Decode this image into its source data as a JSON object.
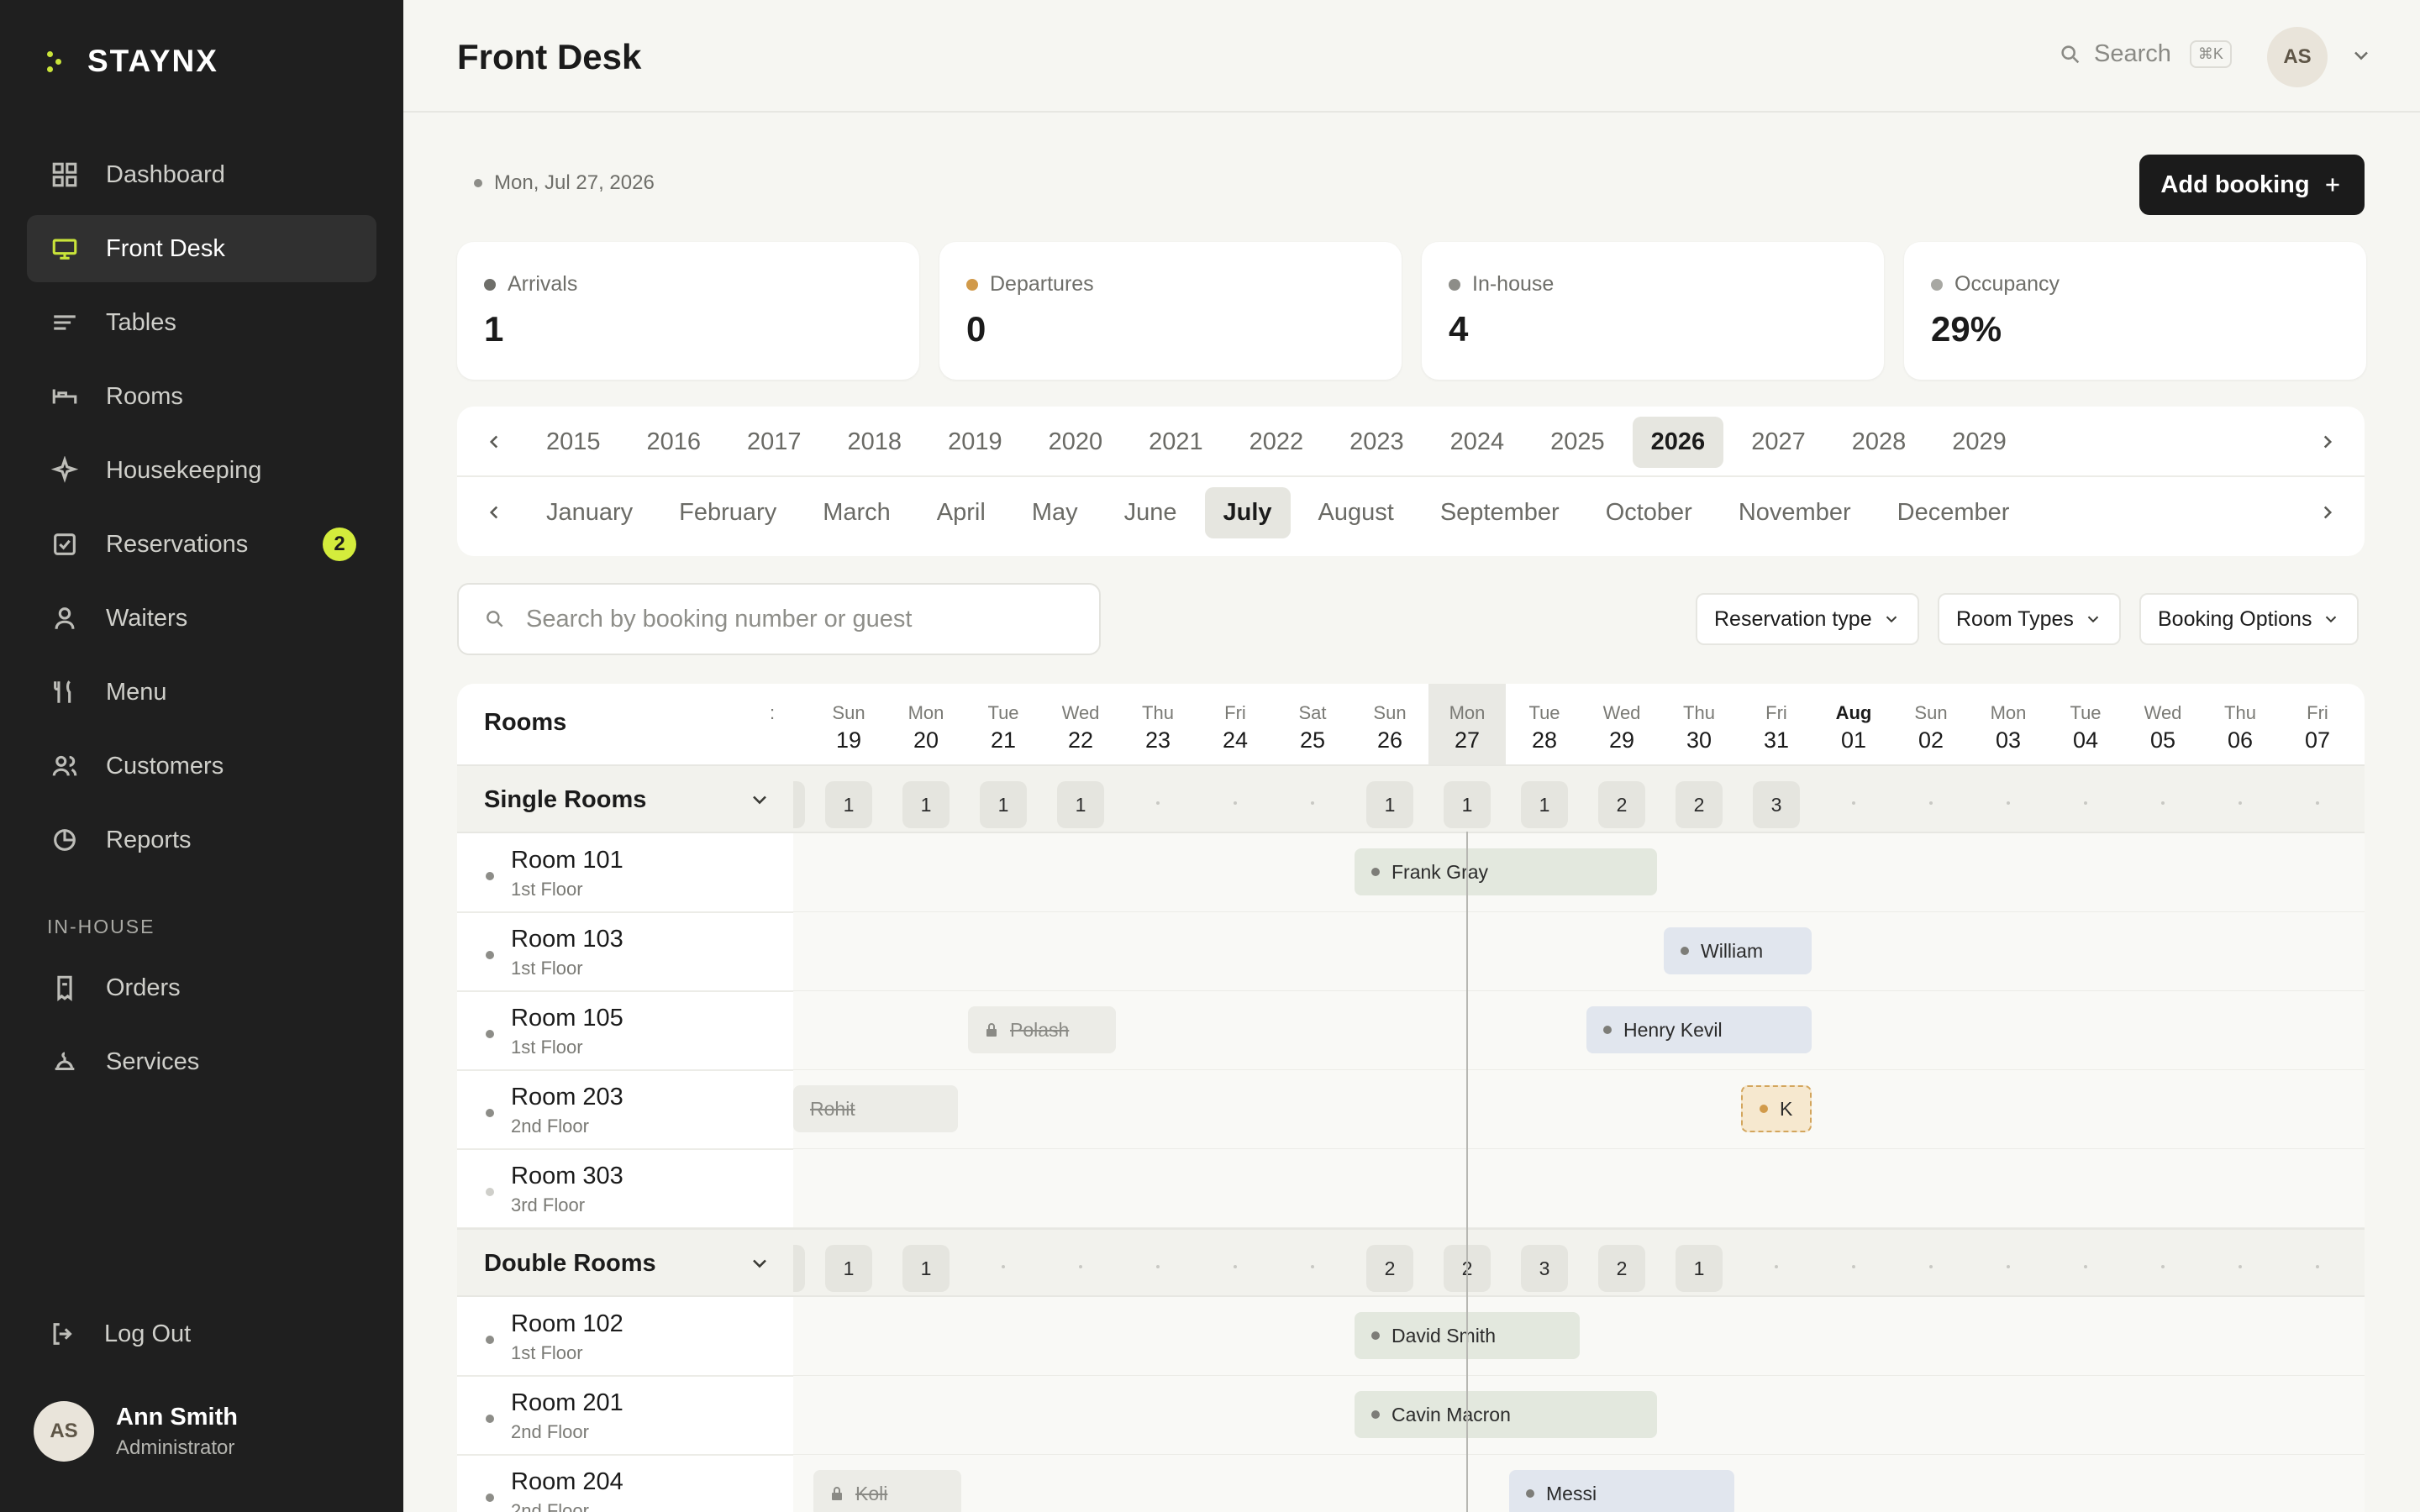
{
  "brand": {
    "name": "STAYNX"
  },
  "sidebar": {
    "items": [
      {
        "label": "Dashboard",
        "icon": "dashboard-icon"
      },
      {
        "label": "Front Desk",
        "icon": "monitor-icon",
        "active": true
      },
      {
        "label": "Tables",
        "icon": "tables-icon"
      },
      {
        "label": "Rooms",
        "icon": "bed-icon"
      },
      {
        "label": "Housekeeping",
        "icon": "sparkle-icon"
      },
      {
        "label": "Reservations",
        "icon": "calendar-check-icon",
        "badge": "2"
      },
      {
        "label": "Waiters",
        "icon": "person-icon"
      },
      {
        "label": "Menu",
        "icon": "fork-knife-icon"
      },
      {
        "label": "Customers",
        "icon": "users-icon"
      },
      {
        "label": "Reports",
        "icon": "pie-chart-icon"
      }
    ],
    "section_label": "IN-HOUSE",
    "section_items": [
      {
        "label": "Orders",
        "icon": "receipt-icon"
      },
      {
        "label": "Services",
        "icon": "concierge-icon"
      }
    ],
    "logout": "Log Out",
    "user": {
      "initials": "AS",
      "name": "Ann Smith",
      "role": "Administrator"
    }
  },
  "header": {
    "title": "Front Desk",
    "search_label": "Search",
    "search_shortcut": "⌘K",
    "avatar": "AS"
  },
  "toolbar": {
    "date": "Mon, Jul 27, 2026",
    "add_booking": "Add booking"
  },
  "stats": [
    {
      "label": "Arrivals",
      "value": "1",
      "color": "#6f6f6a"
    },
    {
      "label": "Departures",
      "value": "0",
      "color": "#d19a4a"
    },
    {
      "label": "In-house",
      "value": "4",
      "color": "#8d8d88"
    },
    {
      "label": "Occupancy",
      "value": "29%",
      "color": "#a8a8a3"
    }
  ],
  "years": [
    "2015",
    "2016",
    "2017",
    "2018",
    "2019",
    "2020",
    "2021",
    "2022",
    "2023",
    "2024",
    "2025",
    "2026",
    "2027",
    "2028",
    "2029"
  ],
  "selected_year": "2026",
  "months": [
    "January",
    "February",
    "March",
    "April",
    "May",
    "June",
    "July",
    "August",
    "September",
    "October",
    "November",
    "December"
  ],
  "selected_month": "July",
  "booking_search": {
    "placeholder": "Search by booking number or guest"
  },
  "filters": [
    "Reservation type",
    "Room Types",
    "Booking Options"
  ],
  "calendar": {
    "rooms_header": "Rooms",
    "partial_day": ":",
    "days": [
      {
        "name": "Sun",
        "date": "19"
      },
      {
        "name": "Mon",
        "date": "20"
      },
      {
        "name": "Tue",
        "date": "21"
      },
      {
        "name": "Wed",
        "date": "22"
      },
      {
        "name": "Thu",
        "date": "23"
      },
      {
        "name": "Fri",
        "date": "24"
      },
      {
        "name": "Sat",
        "date": "25"
      },
      {
        "name": "Sun",
        "date": "26"
      },
      {
        "name": "Mon",
        "date": "27",
        "today": true
      },
      {
        "name": "Tue",
        "date": "28"
      },
      {
        "name": "Wed",
        "date": "29"
      },
      {
        "name": "Thu",
        "date": "30"
      },
      {
        "name": "Fri",
        "date": "31"
      },
      {
        "name": "Aug",
        "date": "01",
        "bold": true
      },
      {
        "name": "Sun",
        "date": "02"
      },
      {
        "name": "Mon",
        "date": "03"
      },
      {
        "name": "Tue",
        "date": "04"
      },
      {
        "name": "Wed",
        "date": "05"
      },
      {
        "name": "Thu",
        "date": "06"
      },
      {
        "name": "Fri",
        "date": "07"
      }
    ],
    "groups": [
      {
        "name": "Single Rooms",
        "counts": [
          "1",
          "1",
          "1",
          "1",
          "",
          "",
          "",
          "1",
          "1",
          "1",
          "2",
          "2",
          "3",
          "",
          "",
          "",
          "",
          "",
          "",
          ""
        ],
        "rooms": [
          {
            "name": "Room 101",
            "floor": "1st Floor",
            "dot": "#8d8d88",
            "bookings": [
              {
                "guest": "Frank Gray",
                "start": 7,
                "span": 4,
                "style": "green"
              }
            ]
          },
          {
            "name": "Room 103",
            "floor": "1st Floor",
            "dot": "#8d8d88",
            "bookings": [
              {
                "guest": "William",
                "start": 11,
                "span": 2,
                "style": "blue"
              }
            ]
          },
          {
            "name": "Room 105",
            "floor": "1st Floor",
            "dot": "#8d8d88",
            "bookings": [
              {
                "guest": "Polash",
                "start": 2,
                "span": 2,
                "style": "gray",
                "locked": true
              },
              {
                "guest": "Henry Kevil",
                "start": 10,
                "span": 3,
                "style": "blue"
              }
            ]
          },
          {
            "name": "Room 203",
            "floor": "2nd Floor",
            "dot": "#8d8d88",
            "bookings": [
              {
                "guest": "Rohit",
                "start": -1,
                "span": 3,
                "style": "gray"
              },
              {
                "guest": "K",
                "start": 12,
                "span": 1,
                "style": "pend"
              }
            ]
          },
          {
            "name": "Room 303",
            "floor": "3rd Floor",
            "dot": "#cfcfca",
            "bookings": []
          }
        ]
      },
      {
        "name": "Double Rooms",
        "counts": [
          "1",
          "1",
          "",
          "",
          "",
          "",
          "",
          "2",
          "2",
          "3",
          "2",
          "1",
          "",
          "",
          "",
          "",
          "",
          "",
          "",
          ""
        ],
        "rooms": [
          {
            "name": "Room 102",
            "floor": "1st Floor",
            "dot": "#8d8d88",
            "bookings": [
              {
                "guest": "David Smith",
                "start": 7,
                "span": 3,
                "style": "green"
              }
            ]
          },
          {
            "name": "Room 201",
            "floor": "2nd Floor",
            "dot": "#8d8d88",
            "bookings": [
              {
                "guest": "Cavin Macron",
                "start": 7,
                "span": 4,
                "style": "green"
              }
            ]
          },
          {
            "name": "Room 204",
            "floor": "2nd Floor",
            "dot": "#8d8d88",
            "bookings": [
              {
                "guest": "Koli",
                "start": 0,
                "span": 2,
                "style": "gray",
                "locked": true
              },
              {
                "guest": "Messi",
                "start": 9,
                "span": 3,
                "style": "blue"
              }
            ]
          }
        ]
      }
    ]
  }
}
